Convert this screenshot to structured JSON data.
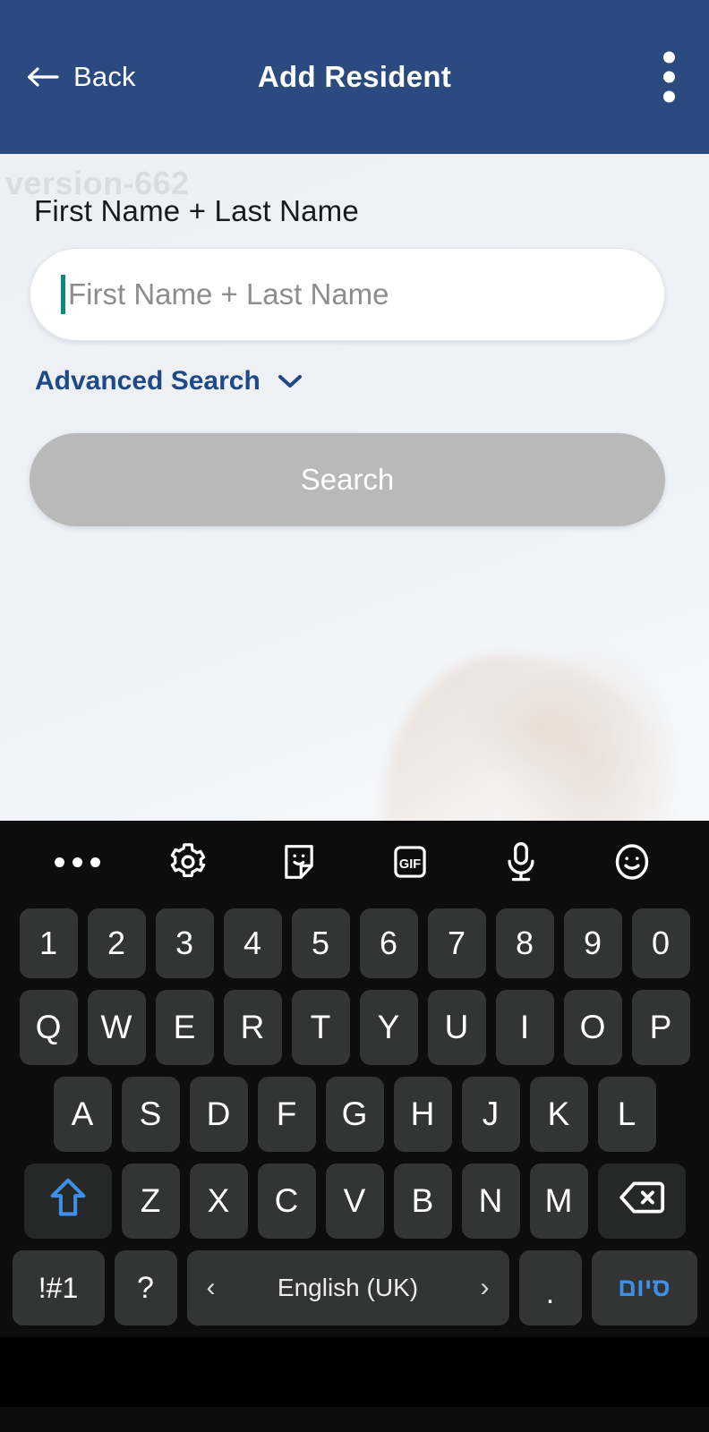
{
  "header": {
    "back_label": "Back",
    "title": "Add Resident",
    "back_icon": "arrow-left-icon",
    "overflow_icon": "more-vertical-icon",
    "bg_color": "#2b4b80"
  },
  "content": {
    "watermark": "version-662",
    "field_label": "First Name + Last Name",
    "search_placeholder": "First Name + Last Name",
    "search_value": "",
    "caret_color": "#0d8a74",
    "advanced_search_label": "Advanced Search",
    "advanced_search_icon": "chevron-down-icon",
    "search_button_label": "Search",
    "search_button_color": "#b9b9b9",
    "accent_color": "#1f4a86"
  },
  "keyboard": {
    "toolbar": [
      {
        "name": "more-options-icon",
        "label": "•••"
      },
      {
        "name": "gear-icon",
        "label": "Settings"
      },
      {
        "name": "sticker-icon",
        "label": "Stickers"
      },
      {
        "name": "gif-icon",
        "label": "GIF"
      },
      {
        "name": "microphone-icon",
        "label": "Voice input"
      },
      {
        "name": "emoji-icon",
        "label": "Emoji"
      }
    ],
    "row_numbers": [
      "1",
      "2",
      "3",
      "4",
      "5",
      "6",
      "7",
      "8",
      "9",
      "0"
    ],
    "row_top": [
      "Q",
      "W",
      "E",
      "R",
      "T",
      "Y",
      "U",
      "I",
      "O",
      "P"
    ],
    "row_home": [
      "A",
      "S",
      "D",
      "F",
      "G",
      "H",
      "J",
      "K",
      "L"
    ],
    "row_bottom": [
      "Z",
      "X",
      "C",
      "V",
      "B",
      "N",
      "M"
    ],
    "shift_icon": "shift-up-arrow-icon",
    "backspace_icon": "backspace-icon",
    "symbols_key": "!#1",
    "question_key": "?",
    "space_label": "English (UK)",
    "space_prev": "‹",
    "space_next": "›",
    "period_key": ".",
    "done_key": "סיום",
    "done_color": "#3d8fe8",
    "shift_color": "#3d8fe8",
    "key_bg": "#333434",
    "keyboard_bg": "#0d0d0d"
  }
}
